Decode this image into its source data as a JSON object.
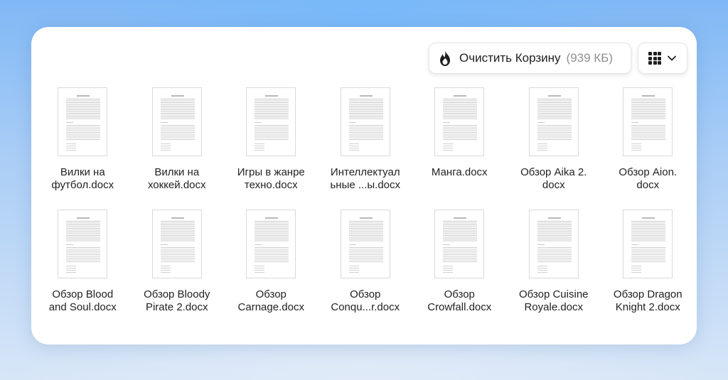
{
  "toolbar": {
    "clear_label": "Очистить Корзину",
    "clear_size": "(939 КБ)",
    "clear_icon": "fire-icon",
    "view_icon": "grid-view-icon",
    "view_chevron_icon": "chevron-down-icon"
  },
  "files": [
    {
      "name": "Вилки на\nфутбол.docx"
    },
    {
      "name": "Вилки на\nхоккей.docx"
    },
    {
      "name": "Игры в жанре\nтехно.docx"
    },
    {
      "name": "Интеллектуал\nьные ...ы.docx"
    },
    {
      "name": "Манга.docx"
    },
    {
      "name": "Обзор Aika 2.\ndocx"
    },
    {
      "name": "Обзор Aion.\ndocx"
    },
    {
      "name": "Обзор Blood\nand Soul.docx"
    },
    {
      "name": "Обзор Bloody\nPirate 2.docx"
    },
    {
      "name": "Обзор\nCarnage.docx"
    },
    {
      "name": "Обзор\nConqu...r.docx"
    },
    {
      "name": "Обзор\nCrowfall.docx"
    },
    {
      "name": "Обзор Cuisine\nRoyale.docx"
    },
    {
      "name": "Обзор Dragon\nKnight 2.docx"
    }
  ]
}
